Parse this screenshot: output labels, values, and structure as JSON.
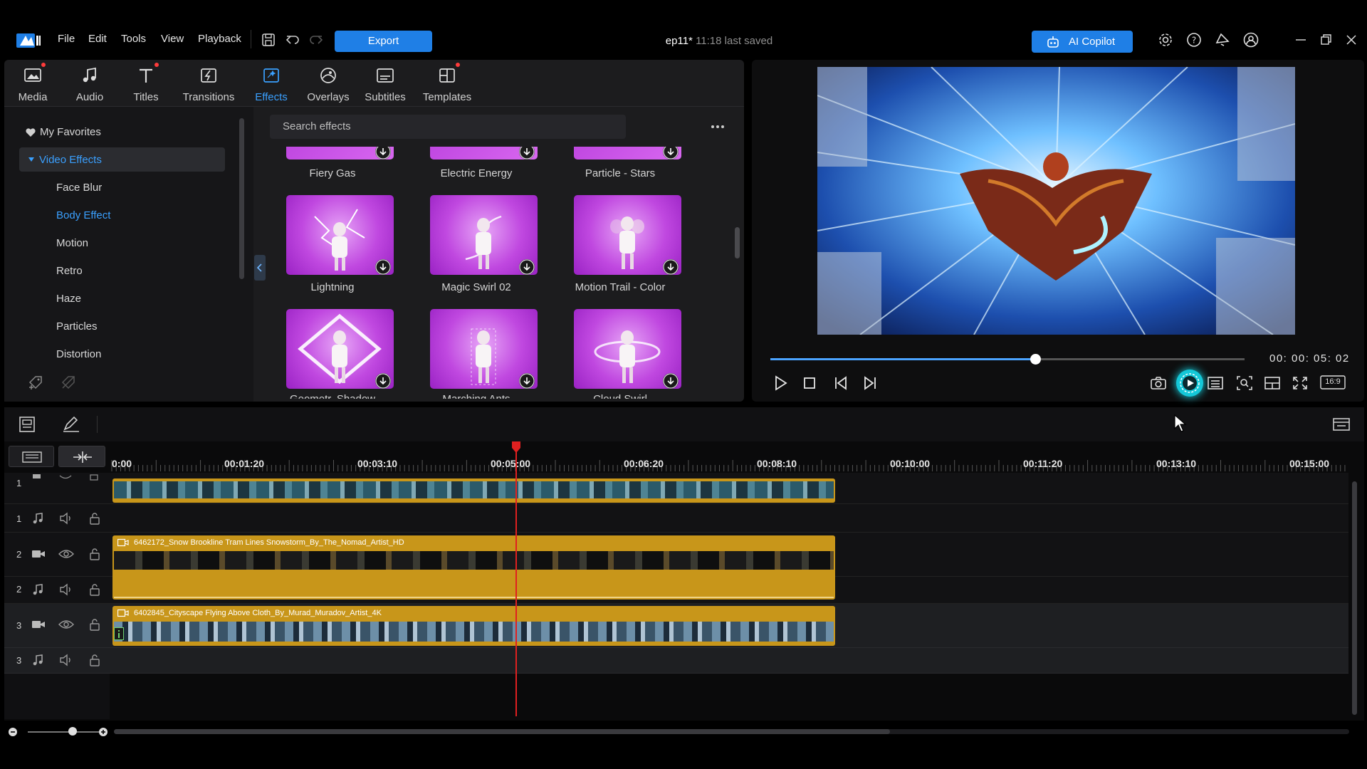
{
  "menu": {
    "file": "File",
    "edit": "Edit",
    "tools": "Tools",
    "view": "View",
    "playback": "Playback",
    "export": "Export"
  },
  "document": {
    "name": "ep11*",
    "saved": "11:18 last saved"
  },
  "copilot": {
    "label": "AI Copilot"
  },
  "library_tabs": [
    {
      "label": "Media",
      "icon": "media-icon",
      "dot": true
    },
    {
      "label": "Audio",
      "icon": "music-note-icon",
      "dot": false
    },
    {
      "label": "Titles",
      "icon": "title-t-icon",
      "dot": true
    },
    {
      "label": "Transitions",
      "icon": "transition-icon",
      "dot": false
    },
    {
      "label": "Effects",
      "icon": "effects-icon",
      "dot": false,
      "active": true
    },
    {
      "label": "Overlays",
      "icon": "overlays-icon",
      "dot": false
    },
    {
      "label": "Subtitles",
      "icon": "subtitles-icon",
      "dot": false
    },
    {
      "label": "Templates",
      "icon": "templates-icon",
      "dot": true
    }
  ],
  "categories": {
    "favorites": "My Favorites",
    "video_effects": "Video Effects",
    "items": [
      "Face Blur",
      "Body Effect",
      "Motion",
      "Retro",
      "Haze",
      "Particles",
      "Distortion"
    ],
    "selected": "Body Effect"
  },
  "search": {
    "placeholder": "Search effects"
  },
  "effects": {
    "row0": [
      "Fiery Gas",
      "Electric Energy",
      "Particle - Stars"
    ],
    "row1": [
      "Lightning",
      "Magic Swirl 02",
      "Motion Trail - Color"
    ],
    "row2": [
      "Geometr. Shadow",
      "Marching Ants",
      "Cloud Swirl"
    ]
  },
  "preview": {
    "timecode": "00: 00: 05: 02",
    "aspect": "16:9",
    "progress": 0.56
  },
  "timeline": {
    "ruler": [
      "0:00",
      "00:01:20",
      "00:03:10",
      "00:05:00",
      "00:06:20",
      "00:08:10",
      "00:10:00",
      "00:11:20",
      "00:13:10",
      "00:15:00"
    ],
    "tracks": [
      "1",
      "1",
      "2",
      "2",
      "3",
      "3"
    ],
    "clips": {
      "track2_video": "6462172_Snow Brookline Tram Lines Snowstorm_By_The_Nomad_Artist_HD",
      "track3_video": "6402845_Cityscape Flying Above Cloth_By_Murad_Muradov_Artist_4K"
    }
  },
  "colors": {
    "accent": "#1f7fe6",
    "active_tab": "#3aa0ff",
    "clip_gold": "#c8961a",
    "playhead": "#e02020",
    "effect_bg": "#c24ee6"
  }
}
